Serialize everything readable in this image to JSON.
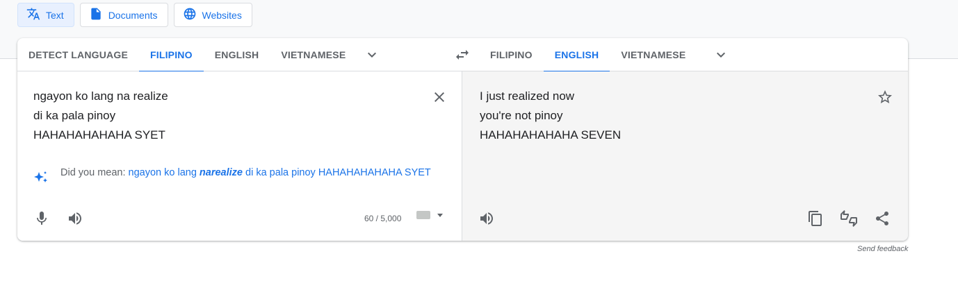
{
  "modes": [
    {
      "label": "Text",
      "icon": "translate-icon",
      "active": true
    },
    {
      "label": "Documents",
      "icon": "document-icon",
      "active": false
    },
    {
      "label": "Websites",
      "icon": "globe-icon",
      "active": false
    }
  ],
  "source_tabs": [
    "DETECT LANGUAGE",
    "FILIPINO",
    "ENGLISH",
    "VIETNAMESE"
  ],
  "target_tabs": [
    "FILIPINO",
    "ENGLISH",
    "VIETNAMESE"
  ],
  "active_source": "FILIPINO",
  "active_target": "ENGLISH",
  "source": {
    "text": "ngayon ko lang na realize\ndi ka pala pinoy\nHAHAHAHAHAHA SYET",
    "did_you_mean_label": "Did you mean: ",
    "suggestion_before": "ngayon ko lang ",
    "suggestion_bold": "narealize",
    "suggestion_after": " di ka pala pinoy HAHAHAHAHAHA SYET",
    "char_count": "60 / 5,000"
  },
  "target": {
    "text": "I just realized now\nyou're not pinoy\nHAHAHAHAHAHA SEVEN"
  },
  "feedback_label": "Send feedback",
  "colors": {
    "accent": "#1a73e8",
    "target_bg": "#f5f5f5",
    "text": "#202124"
  }
}
